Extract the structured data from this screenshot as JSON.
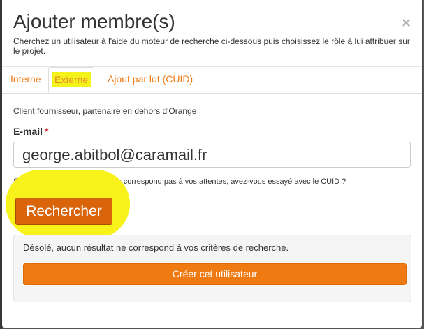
{
  "modal": {
    "title": "Ajouter membre(s)",
    "close_label": "×",
    "description": "Cherchez un utilisateur à l'aide du moteur de recherche ci-dessous puis choisissez le rôle à lui attribuer sur le projet."
  },
  "tabs": [
    {
      "label": "Interne",
      "active": false
    },
    {
      "label": "Externe",
      "active": true
    },
    {
      "label": "Ajout par lot (CUID)",
      "active": false
    }
  ],
  "form": {
    "subtitle": "Client fournisseur, partenaire en dehors d'Orange",
    "email_label": "E-mail",
    "required_mark": "*",
    "email_value": "george.abitbol@caramail.fr",
    "hint": "Si le résultat de la recherche ne correspond pas à vos attentes, avez-vous essayé avec le CUID ?",
    "search_label": "Rechercher"
  },
  "result": {
    "message": "Désolé, aucun résultat ne correspond à vos critères de recherche.",
    "create_label": "Créer cet utilisateur"
  },
  "colors": {
    "accent": "#f07a12",
    "search_button": "#d9640a",
    "highlight": "#f6f21a",
    "required": "#d9262c"
  }
}
